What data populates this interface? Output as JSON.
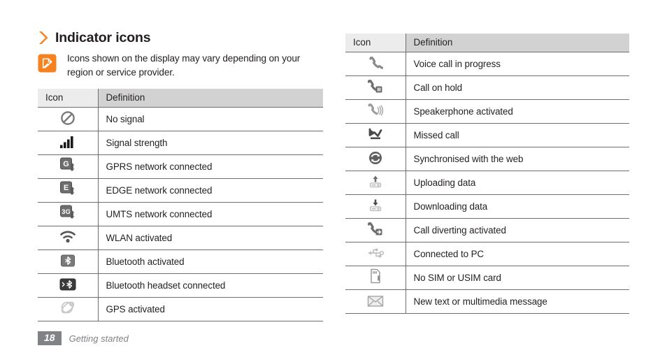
{
  "heading": {
    "chevron_icon": "chevron-right-icon",
    "title": "Indicator icons"
  },
  "note": {
    "icon": "note-pencil-icon",
    "text": "Icons shown on the display may vary depending on your region or service provider."
  },
  "colors": {
    "accent_orange": "#f5821f",
    "header_icon_bg": "#ececec",
    "header_def_bg": "#d2d2d2",
    "border": "#6d6e71",
    "text": "#231f20",
    "footer_gray": "#808285"
  },
  "tables": [
    {
      "id": "indicator-table-left",
      "columns": [
        "Icon",
        "Definition"
      ],
      "rows": [
        {
          "icon": "no-signal-icon",
          "definition": "No signal"
        },
        {
          "icon": "signal-strength-icon",
          "definition": "Signal strength"
        },
        {
          "icon": "gprs-network-icon",
          "definition": "GPRS network connected"
        },
        {
          "icon": "edge-network-icon",
          "definition": "EDGE network connected"
        },
        {
          "icon": "umts-network-icon",
          "definition": "UMTS network connected"
        },
        {
          "icon": "wlan-icon",
          "definition": "WLAN activated"
        },
        {
          "icon": "bluetooth-icon",
          "definition": "Bluetooth activated"
        },
        {
          "icon": "bluetooth-headset-icon",
          "definition": "Bluetooth headset connected"
        },
        {
          "icon": "gps-icon",
          "definition": "GPS activated"
        }
      ]
    },
    {
      "id": "indicator-table-right",
      "columns": [
        "Icon",
        "Definition"
      ],
      "rows": [
        {
          "icon": "voice-call-icon",
          "definition": "Voice call in progress"
        },
        {
          "icon": "call-on-hold-icon",
          "definition": "Call on hold"
        },
        {
          "icon": "speakerphone-icon",
          "definition": "Speakerphone activated"
        },
        {
          "icon": "missed-call-icon",
          "definition": "Missed call"
        },
        {
          "icon": "sync-web-icon",
          "definition": "Synchronised with the web"
        },
        {
          "icon": "upload-data-icon",
          "definition": "Uploading data"
        },
        {
          "icon": "download-data-icon",
          "definition": "Downloading data"
        },
        {
          "icon": "call-diverting-icon",
          "definition": "Call diverting activated"
        },
        {
          "icon": "usb-connected-icon",
          "definition": "Connected to PC"
        },
        {
          "icon": "no-sim-card-icon",
          "definition": "No SIM or USIM card"
        },
        {
          "icon": "new-message-icon",
          "definition": "New text or multimedia message"
        }
      ]
    }
  ],
  "footer": {
    "page_number": "18",
    "section": "Getting started"
  }
}
